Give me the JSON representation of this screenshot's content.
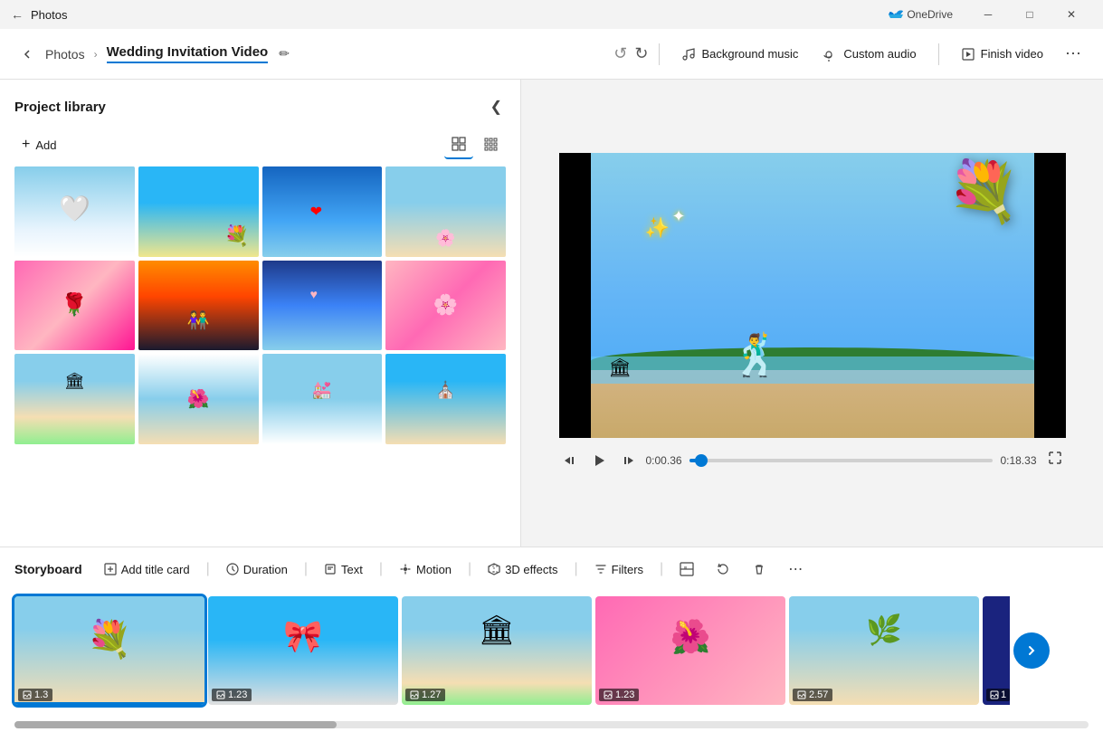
{
  "titlebar": {
    "app_name": "Photos",
    "onedrive_label": "OneDrive",
    "minimize_label": "─",
    "maximize_label": "□",
    "close_label": "✕"
  },
  "toolbar": {
    "back_icon": "←",
    "app_label": "Photos",
    "arrow_sep": "›",
    "title": "Wedding Invitation Video",
    "edit_icon": "✏",
    "undo_icon": "↺",
    "redo_icon": "↻",
    "bg_music_label": "Background music",
    "custom_audio_label": "Custom audio",
    "finish_video_label": "Finish video",
    "more_icon": "⋯"
  },
  "library": {
    "title": "Project library",
    "collapse_icon": "❮",
    "add_label": "Add",
    "add_icon": "+",
    "view_large_icon": "⊞",
    "view_small_icon": "⊟",
    "thumbnails": [
      {
        "id": 1,
        "color_class": "thumb-sky"
      },
      {
        "id": 2,
        "color_class": "thumb-beach"
      },
      {
        "id": 3,
        "color_class": "thumb-blue"
      },
      {
        "id": 4,
        "color_class": "thumb-ceremony"
      },
      {
        "id": 5,
        "color_class": "thumb-rose"
      },
      {
        "id": 6,
        "color_class": "thumb-sunset"
      },
      {
        "id": 7,
        "color_class": "thumb-clouds"
      },
      {
        "id": 8,
        "color_class": "thumb-petals"
      },
      {
        "id": 9,
        "color_class": "thumb-arch"
      },
      {
        "id": 10,
        "color_class": "thumb-white"
      },
      {
        "id": 11,
        "color_class": "thumb-decor"
      },
      {
        "id": 12,
        "color_class": "thumb-ceremony"
      }
    ]
  },
  "preview": {
    "time_current": "0:00.36",
    "time_total": "0:18.33",
    "progress_pct": 4
  },
  "storyboard": {
    "title": "Storyboard",
    "add_title_card_label": "Add title card",
    "duration_label": "Duration",
    "text_label": "Text",
    "motion_label": "Motion",
    "effects_3d_label": "3D effects",
    "filters_label": "Filters",
    "more_icon": "⋯",
    "items": [
      {
        "id": 1,
        "duration": "1.3",
        "color_class": "thumb-sky",
        "selected": true
      },
      {
        "id": 2,
        "duration": "1.23",
        "color_class": "thumb-beach",
        "selected": false
      },
      {
        "id": 3,
        "duration": "1.27",
        "color_class": "thumb-ceremony",
        "selected": false
      },
      {
        "id": 4,
        "duration": "1.23",
        "color_class": "thumb-rose",
        "selected": false
      },
      {
        "id": 5,
        "duration": "2.57",
        "color_class": "thumb-arch",
        "selected": false
      }
    ]
  },
  "icons": {
    "image_icon": "🖼",
    "music_note": "♫",
    "audio_icon": "🎵"
  }
}
